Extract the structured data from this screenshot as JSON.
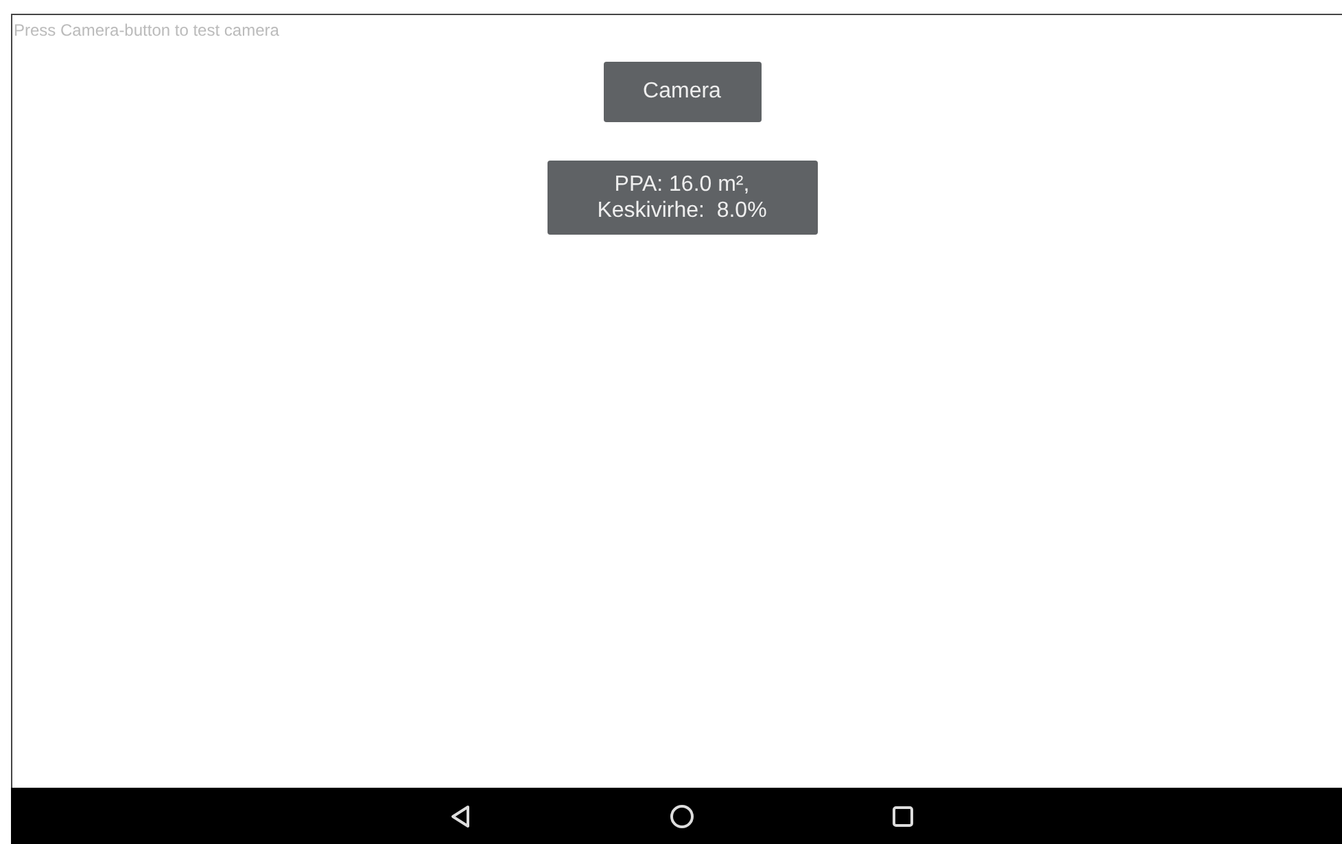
{
  "hint": "Press Camera-button to test camera",
  "camera_button": {
    "label": "Camera"
  },
  "result": {
    "lines": [
      "PPA: 16.0 m²,",
      "Keskivirhe:  8.0%"
    ]
  },
  "nav_bar": {
    "buttons": [
      {
        "kind": "back"
      },
      {
        "kind": "home"
      },
      {
        "kind": "recents"
      }
    ]
  }
}
